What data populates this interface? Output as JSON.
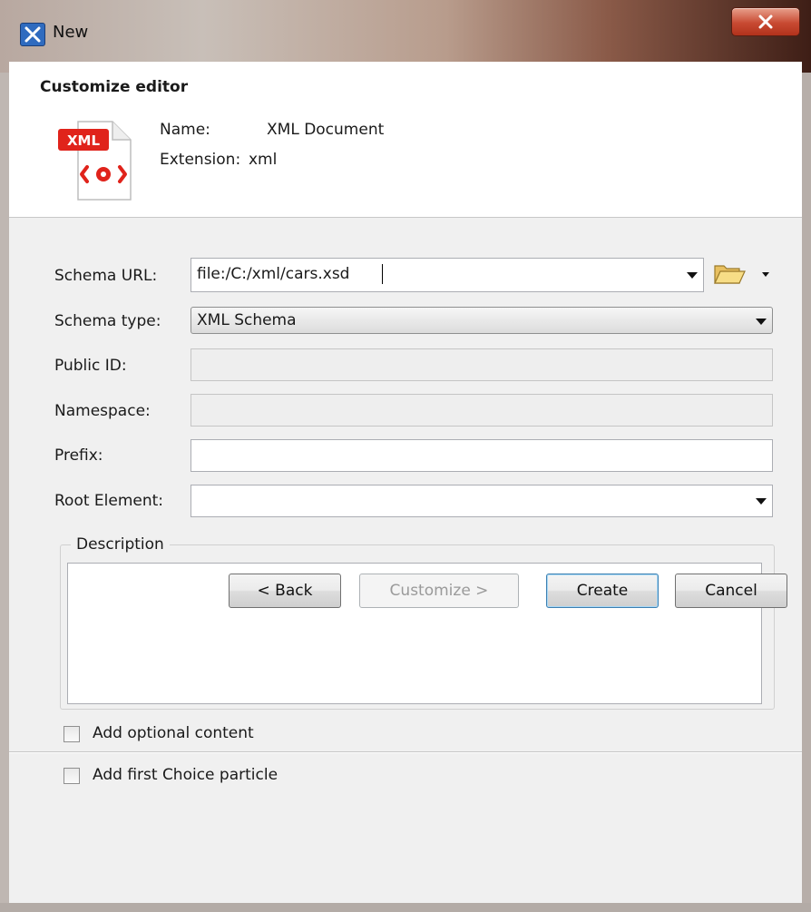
{
  "window": {
    "title": "New",
    "close_icon": "close-icon",
    "app_icon": "app-x-icon"
  },
  "header": {
    "heading": "Customize editor",
    "icon": "xml-document-icon",
    "icon_badge": "XML",
    "name_label": "Name:",
    "name_value": "XML Document",
    "extension_label": "Extension:",
    "extension_value": "xml"
  },
  "form": {
    "schema_url_label": "Schema URL:",
    "schema_url_value": "file:/C:/xml/cars.xsd",
    "schema_type_label": "Schema type:",
    "schema_type_value": "XML Schema",
    "public_id_label": "Public ID:",
    "public_id_value": "",
    "namespace_label": "Namespace:",
    "namespace_value": "",
    "prefix_label": "Prefix:",
    "prefix_value": "",
    "root_element_label": "Root Element:",
    "root_element_value": "",
    "description_label": "Description",
    "description_value": "",
    "add_optional_label": "Add optional content",
    "add_optional_checked": false,
    "add_choice_label": "Add first Choice particle",
    "add_choice_checked": false
  },
  "buttons": {
    "back": "< Back",
    "customize": "Customize >",
    "create": "Create",
    "cancel": "Cancel"
  },
  "colors": {
    "close_button": "#c84a32",
    "badge_red": "#e0231b",
    "folder_yellow": "#f2c94c"
  }
}
